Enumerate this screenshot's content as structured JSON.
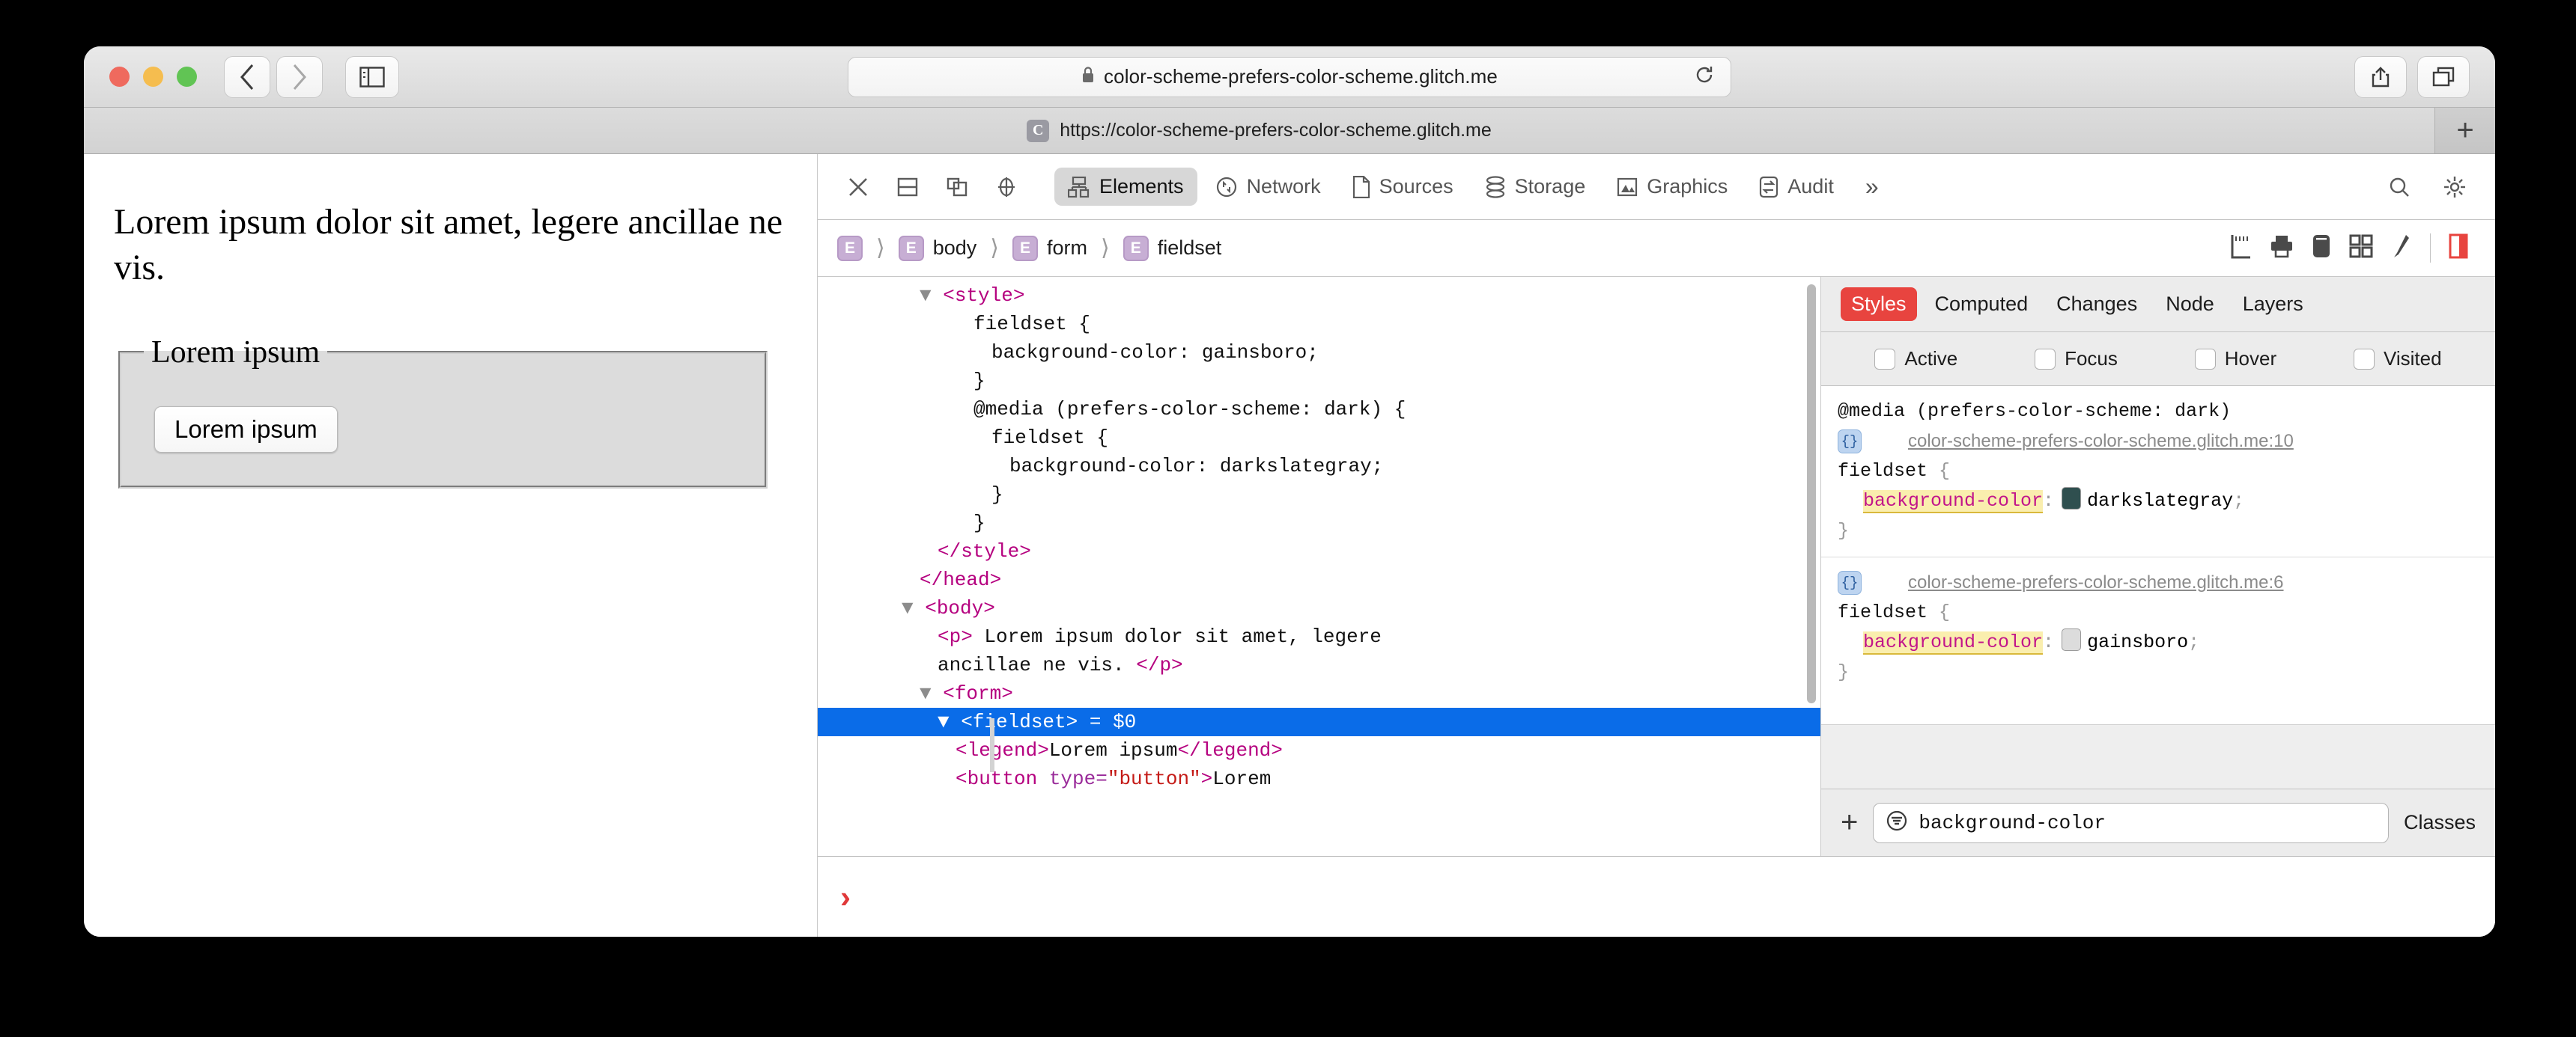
{
  "browser": {
    "url_display": "color-scheme-prefers-color-scheme.glitch.me",
    "tab_favicon_letter": "C",
    "tab_title": "https://color-scheme-prefers-color-scheme.glitch.me",
    "lock_icon": "lock-icon",
    "reload_icon": "reload-icon",
    "back_icon": "chevron-left-icon",
    "forward_icon": "chevron-right-icon",
    "sidebar_icon": "sidebar-icon",
    "share_icon": "share-icon",
    "tabs_overview_icon": "tabs-overview-icon",
    "new_tab_label": "+"
  },
  "page": {
    "paragraph": "Lorem ipsum dolor sit amet, legere ancillae ne vis.",
    "legend": "Lorem ipsum",
    "button_label": "Lorem ipsum"
  },
  "devtools": {
    "toolbar_icons": [
      "close-icon",
      "dock-bottom-icon",
      "dock-right-icon",
      "inspect-element-icon"
    ],
    "tabs": [
      {
        "label": "Elements",
        "icon": "elements-icon",
        "active": true
      },
      {
        "label": "Network",
        "icon": "network-icon",
        "active": false
      },
      {
        "label": "Sources",
        "icon": "sources-icon",
        "active": false
      },
      {
        "label": "Storage",
        "icon": "storage-icon",
        "active": false
      },
      {
        "label": "Graphics",
        "icon": "graphics-icon",
        "active": false
      },
      {
        "label": "Audit",
        "icon": "audit-icon",
        "active": false
      }
    ],
    "overflow_label": "»",
    "search_icon": "search-icon",
    "settings_icon": "gear-icon",
    "breadcrumb": [
      {
        "badge": "E",
        "label": ""
      },
      {
        "badge": "E",
        "label": "body"
      },
      {
        "badge": "E",
        "label": "form"
      },
      {
        "badge": "E",
        "label": "fieldset"
      }
    ],
    "breadcrumb_tools": [
      "ruler-icon",
      "print-icon",
      "device-icon",
      "grid-icon",
      "paintbrush-icon",
      "layout-panel-icon"
    ],
    "dom_lines": [
      {
        "indent": 4,
        "parts": [
          {
            "t": "▼ ",
            "c": "arrow"
          },
          {
            "t": "<style>",
            "c": "tag"
          }
        ]
      },
      {
        "indent": 7,
        "parts": [
          {
            "t": "fieldset {",
            "c": "plain"
          }
        ]
      },
      {
        "indent": 8,
        "parts": [
          {
            "t": "background-color: gainsboro;",
            "c": "plain"
          }
        ]
      },
      {
        "indent": 7,
        "parts": [
          {
            "t": "}",
            "c": "plain"
          }
        ]
      },
      {
        "indent": 7,
        "parts": [
          {
            "t": "@media (prefers-color-scheme: dark) {",
            "c": "plain"
          }
        ]
      },
      {
        "indent": 8,
        "parts": [
          {
            "t": "fieldset {",
            "c": "plain"
          }
        ]
      },
      {
        "indent": 9,
        "parts": [
          {
            "t": "background-color: darkslategray;",
            "c": "plain"
          }
        ]
      },
      {
        "indent": 8,
        "parts": [
          {
            "t": "}",
            "c": "plain"
          }
        ]
      },
      {
        "indent": 7,
        "parts": [
          {
            "t": "}",
            "c": "plain"
          }
        ]
      },
      {
        "indent": 5,
        "parts": [
          {
            "t": "</style>",
            "c": "tag"
          }
        ]
      },
      {
        "indent": 4,
        "parts": [
          {
            "t": "</head>",
            "c": "tag"
          }
        ]
      },
      {
        "indent": 3,
        "parts": [
          {
            "t": "▼ ",
            "c": "arrow"
          },
          {
            "t": "<body>",
            "c": "tag"
          }
        ]
      },
      {
        "indent": 5,
        "parts": [
          {
            "t": "<p>",
            "c": "tag"
          },
          {
            "t": " Lorem ipsum dolor sit amet, legere",
            "c": "plain"
          }
        ]
      },
      {
        "indent": 5,
        "parts": [
          {
            "t": "ancillae ne vis. ",
            "c": "plain"
          },
          {
            "t": "</p>",
            "c": "tag"
          }
        ]
      },
      {
        "indent": 4,
        "parts": [
          {
            "t": "▼ ",
            "c": "arrow"
          },
          {
            "t": "<form>",
            "c": "tag"
          }
        ]
      },
      {
        "indent": 5,
        "selected": true,
        "parts": [
          {
            "t": "▼ ",
            "c": "arrow"
          },
          {
            "t": "<fieldset>",
            "c": "tag"
          },
          {
            "t": " = ",
            "c": "eq"
          },
          {
            "t": "$0",
            "c": "eq"
          }
        ]
      },
      {
        "indent": 6,
        "parts": [
          {
            "t": "<legend>",
            "c": "tag"
          },
          {
            "t": "Lorem ipsum",
            "c": "plain"
          },
          {
            "t": "</legend>",
            "c": "tag"
          }
        ]
      },
      {
        "indent": 6,
        "parts": [
          {
            "t": "<button ",
            "c": "tag"
          },
          {
            "t": "type=",
            "c": "attr"
          },
          {
            "t": "\"button\"",
            "c": "val"
          },
          {
            "t": ">",
            "c": "tag"
          },
          {
            "t": "Lorem",
            "c": "plain"
          }
        ]
      }
    ],
    "styles": {
      "tabs": [
        {
          "label": "Styles",
          "active": true
        },
        {
          "label": "Computed",
          "active": false
        },
        {
          "label": "Changes",
          "active": false
        },
        {
          "label": "Node",
          "active": false
        },
        {
          "label": "Layers",
          "active": false
        }
      ],
      "pseudo_states": [
        {
          "label": "Active",
          "checked": false
        },
        {
          "label": "Focus",
          "checked": false
        },
        {
          "label": "Hover",
          "checked": false
        },
        {
          "label": "Visited",
          "checked": false
        }
      ],
      "rules": [
        {
          "media": "@media (prefers-color-scheme: dark)",
          "source": "color-scheme-prefers-color-scheme.glitch.me:10",
          "selector": "fieldset",
          "property": "background-color",
          "value": "darkslategray",
          "swatch_color": "#2f4f4f"
        },
        {
          "media": "",
          "source": "color-scheme-prefers-color-scheme.glitch.me:6",
          "selector": "fieldset",
          "property": "background-color",
          "value": "gainsboro",
          "swatch_color": "#dcdcdc"
        }
      ],
      "filter_value": "background-color",
      "filter_icon": "filter-icon",
      "add_label": "+",
      "classes_label": "Classes"
    },
    "console_prompt": "›"
  }
}
